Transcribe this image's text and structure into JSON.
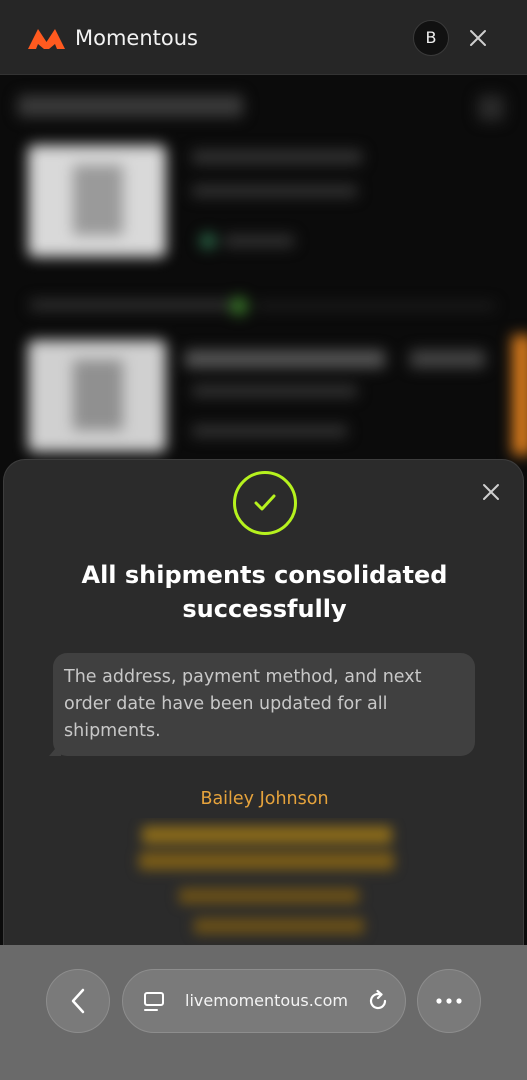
{
  "header": {
    "brand": "Momentous",
    "avatar_initial": "B",
    "accent_color": "#ff5a1f"
  },
  "modal": {
    "title": "All shipments consolidated successfully",
    "message": "The address, payment method, and next order date have been updated for all shipments.",
    "signature": "Bailey Johnson",
    "check_color": "#b6f21e",
    "signature_color": "#e6a33c"
  },
  "browser": {
    "url": "livemomentous.com"
  },
  "icons": {
    "logo": "momentous-logo-icon",
    "avatar": "avatar",
    "header_close": "close-icon",
    "success": "check-icon",
    "modal_close": "close-icon",
    "back": "chevron-left-icon",
    "tabs": "tabs-icon",
    "reload": "reload-icon",
    "more": "more-icon"
  }
}
